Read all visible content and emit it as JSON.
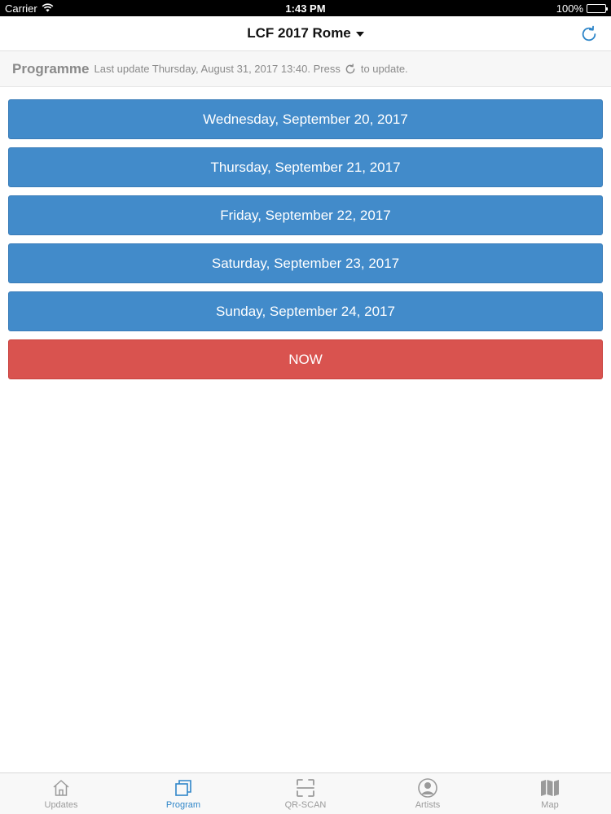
{
  "status_bar": {
    "carrier": "Carrier",
    "time": "1:43 PM",
    "battery": "100%",
    "battery_level": 1.0
  },
  "nav": {
    "title": "LCF 2017 Rome",
    "refresh_icon": "refresh-icon"
  },
  "info": {
    "heading": "Programme",
    "text_before": "Last update Thursday, August 31, 2017 13:40. Press",
    "text_after": "to update."
  },
  "days": [
    {
      "label": "Wednesday, September 20, 2017"
    },
    {
      "label": "Thursday, September 21, 2017"
    },
    {
      "label": "Friday, September 22, 2017"
    },
    {
      "label": "Saturday, September 23, 2017"
    },
    {
      "label": "Sunday, September 24, 2017"
    }
  ],
  "now_button": {
    "label": "NOW"
  },
  "tabs": [
    {
      "label": "Updates",
      "icon": "home-icon",
      "active": false
    },
    {
      "label": "Program",
      "icon": "program-icon",
      "active": true
    },
    {
      "label": "QR-SCAN",
      "icon": "qr-scan-icon",
      "active": false
    },
    {
      "label": "Artists",
      "icon": "artist-icon",
      "active": false
    },
    {
      "label": "Map",
      "icon": "map-icon",
      "active": false
    }
  ],
  "colors": {
    "day_button": "#428bca",
    "now_button": "#d9534f",
    "active_tab": "#2f86c9",
    "inactive_tab": "#9a9a9a"
  }
}
